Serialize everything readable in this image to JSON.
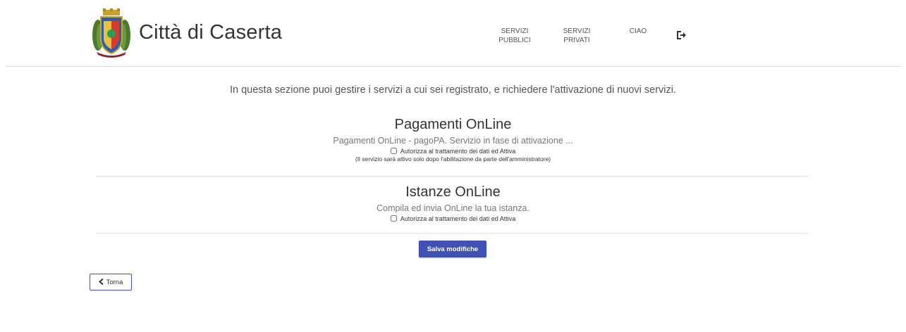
{
  "header": {
    "site_title": "Città di Caserta",
    "nav": {
      "servizi_pubblici_line1": "SERVIZI",
      "servizi_pubblici_line2": "PUBBLICI",
      "servizi_privati_line1": "SERVIZI",
      "servizi_privati_line2": "PRIVATI",
      "ciao": "CIAO"
    },
    "logout_icon": "sign-out-icon"
  },
  "main": {
    "intro": "In questa sezione puoi gestire i servizi a cui sei registrato, e richiedere l'attivazione di nuovi servizi.",
    "services": [
      {
        "title": "Pagamenti OnLine",
        "description": "Pagamenti OnLine - pagoPA. Servizio in fase di attivazione ...",
        "checkbox_label": "Autorizza al trattamento dei dati ed Attiva",
        "checked": false,
        "note": "(Il servizio sarà attivo solo dopo l'abilitazione da parte dell'amministratore)"
      },
      {
        "title": "Istanze OnLine",
        "description": "Compila ed invia OnLine la tua istanza.",
        "checkbox_label": "Autorizza al trattamento dei dati ed Attiva",
        "checked": false
      }
    ],
    "save_label": "Salva modifiche",
    "back_label": "Torna"
  },
  "colors": {
    "primary": "#3f51b5",
    "divider": "#e3e3e3",
    "text": "#333333"
  }
}
